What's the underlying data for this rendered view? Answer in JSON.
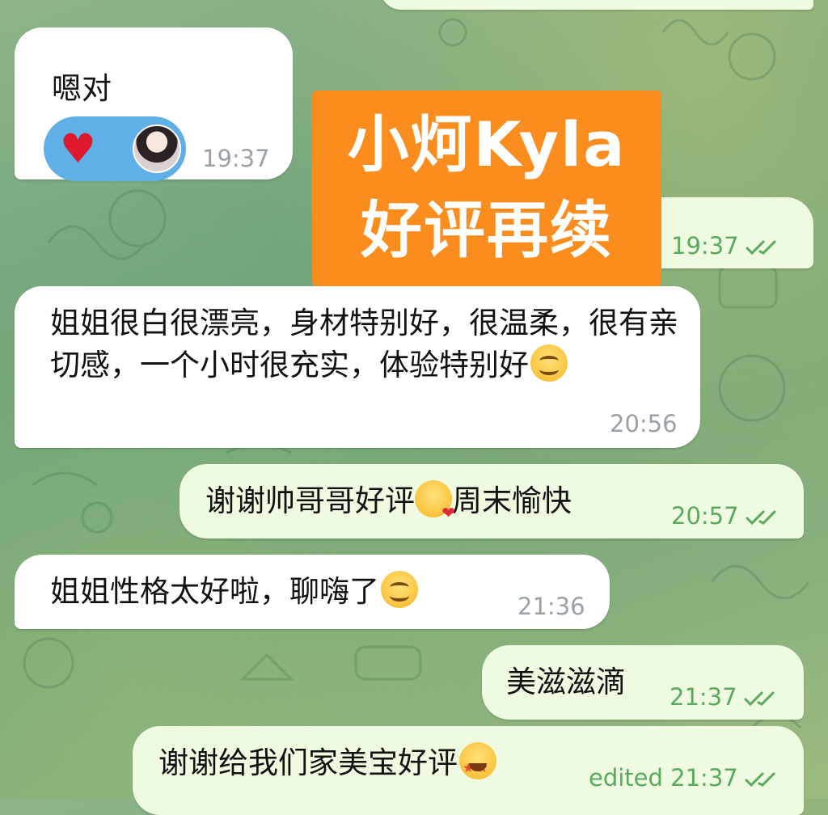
{
  "overlay": {
    "line1": "小炣Kyla",
    "line2": "好评再续"
  },
  "messages": [
    {
      "dir": "in",
      "text": "嗯对",
      "time": "19:37",
      "reactions": [
        "heart",
        "avatar"
      ]
    },
    {
      "dir": "out",
      "text": "",
      "time": "19:37",
      "status": "read"
    },
    {
      "dir": "in",
      "text": "姐姐很白很漂亮，身材特别好，很温柔，很有亲切感，一个小时很充实，体验特别好",
      "emoji": "smiling-face",
      "time": "20:56"
    },
    {
      "dir": "out",
      "text_before": "谢谢帅哥哥好评",
      "emoji": "kissing-face",
      "text_after": "周末愉快",
      "time": "20:57",
      "status": "read"
    },
    {
      "dir": "in",
      "text": "姐姐性格太好啦，聊嗨了",
      "emoji": "smiling-face",
      "time": "21:36"
    },
    {
      "dir": "out",
      "text": "美滋滋滴",
      "time": "21:37",
      "status": "read"
    },
    {
      "dir": "out",
      "text": "谢谢给我们家美宝好评",
      "emoji": "star-struck-face",
      "edited": "edited",
      "time": "21:37",
      "status": "read"
    }
  ]
}
